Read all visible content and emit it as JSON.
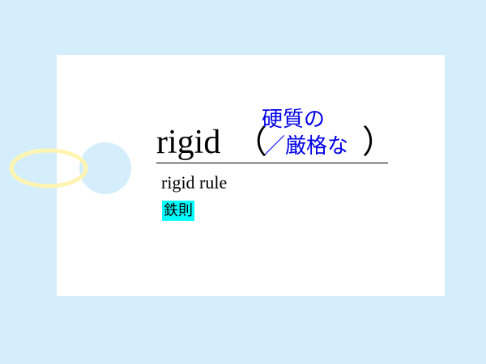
{
  "card": {
    "word": "rigid",
    "paren_open": "（",
    "paren_close": "）",
    "meaning_line1": "硬質の",
    "meaning_line2": "／厳格な",
    "example": "rigid rule",
    "translation": "鉄則"
  },
  "colors": {
    "background": "#d4eefb",
    "meaning": "#0000e6",
    "highlight": "#00ffff",
    "ring": "#fff4b0"
  }
}
